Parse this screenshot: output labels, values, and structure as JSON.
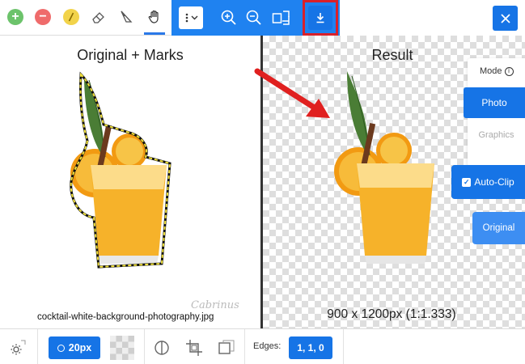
{
  "toolbar": {
    "tools": [
      {
        "name": "add-mark-tool",
        "icon": "plus-circle-icon",
        "color": "#6cc36b"
      },
      {
        "name": "remove-mark-tool",
        "icon": "minus-circle-icon",
        "color": "#ef6b6b"
      },
      {
        "name": "hair-mark-tool",
        "icon": "slash-circle-icon",
        "color": "#f2d34a"
      },
      {
        "name": "eraser-tool",
        "icon": "eraser-icon"
      },
      {
        "name": "scalpel-tool",
        "icon": "scalpel-icon"
      },
      {
        "name": "pan-tool",
        "icon": "hand-icon",
        "active": true
      }
    ],
    "menu_icon": "more-vertical-icon",
    "zoom_in_icon": "zoom-in-icon",
    "zoom_out_icon": "zoom-out-icon",
    "fit_icon": "fit-screen-icon",
    "download_icon": "download-icon",
    "close_icon": "close-icon",
    "accent_color": "#1f82f0",
    "highlight_color": "#d9202a"
  },
  "left_pane": {
    "title": "Original + Marks",
    "filename": "cocktail-white-background-photography.jpg",
    "watermark": "Cabrinus"
  },
  "right_pane": {
    "title": "Result",
    "dimensions": "900 x 1200px (1:1.333)"
  },
  "side_panel": {
    "mode_label": "Mode",
    "mode_info_icon": "info-icon",
    "photo_label": "Photo",
    "graphics_label": "Graphics",
    "autoclip_label": "Auto-Clip",
    "autoclip_checked": true,
    "original_label": "Original"
  },
  "bottom_bar": {
    "settings_icon": "settings-icon",
    "brush_size": "20px",
    "edges_label": "Edges:",
    "edges_value": "1, 1, 0"
  }
}
